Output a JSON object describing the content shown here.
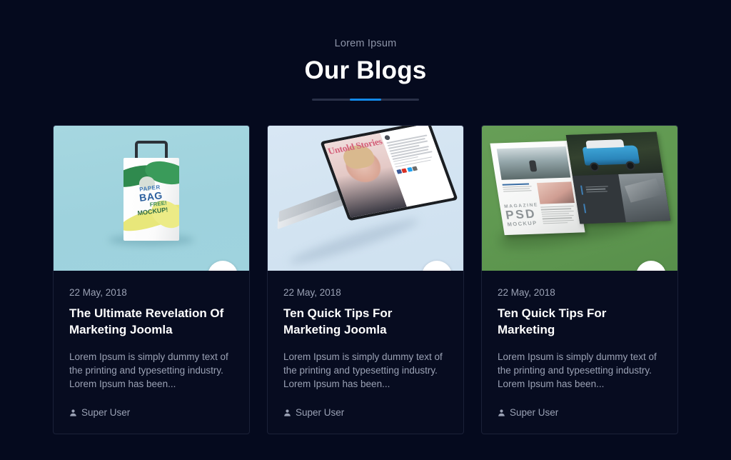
{
  "section": {
    "eyebrow": "Lorem Ipsum",
    "title": "Our Blogs",
    "accent_color": "#1289e8",
    "background_color": "#050a1e"
  },
  "cards": [
    {
      "date": "22 May, 2018",
      "title": "The Ultimate Revelation Of Marketing Joomla",
      "excerpt": "Lorem Ipsum is simply dummy text of the printing and typesetting industry. Lorem Ipsum has been...",
      "author": "Super User",
      "image_alt": "paper-bag-mockup",
      "image_background": "#9ed2dd",
      "preview_icon": "eye-icon",
      "image_text": {
        "line1": "PAPER",
        "line2": "BAG",
        "line3": "FREE!",
        "line4": "MOCKUP!"
      }
    },
    {
      "date": "22 May, 2018",
      "title": "Ten Quick Tips For Marketing Joomla",
      "excerpt": "Lorem Ipsum is simply dummy text of the printing and typesetting industry. Lorem Ipsum has been...",
      "author": "Super User",
      "image_alt": "laptop-website-mockup",
      "image_background": "#d2e3f1",
      "preview_icon": "eye-icon",
      "image_text": {
        "headline": "Untold Stories"
      }
    },
    {
      "date": "22 May, 2018",
      "title": "Ten Quick Tips For Marketing",
      "excerpt": "Lorem Ipsum is simply dummy text of the printing and typesetting industry. Lorem Ipsum has been...",
      "author": "Super User",
      "image_alt": "magazine-psd-mockup",
      "image_background": "#5f9850",
      "preview_icon": "eye-icon",
      "image_text": {
        "line1": "MAGAZINE",
        "line2": "PSD",
        "line3": "MOCKUP"
      }
    }
  ]
}
